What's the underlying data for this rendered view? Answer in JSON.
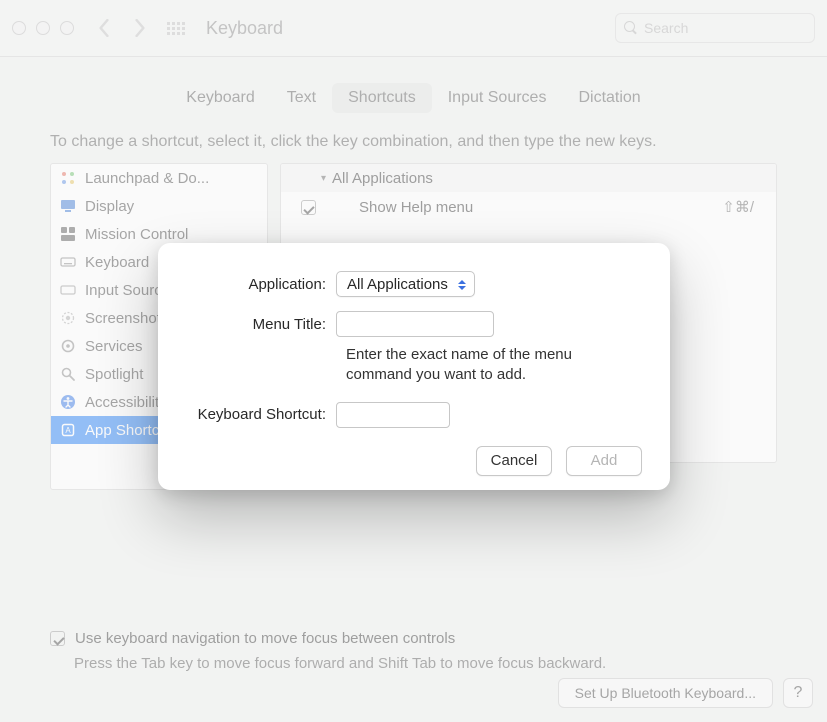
{
  "window": {
    "title": "Keyboard",
    "search_placeholder": "Search"
  },
  "tabs": {
    "items": [
      "Keyboard",
      "Text",
      "Shortcuts",
      "Input Sources",
      "Dictation"
    ],
    "active_index": 2
  },
  "instructions": "To change a shortcut, select it, click the key combination, and then type the new keys.",
  "sidebar": {
    "items": [
      {
        "label": "Launchpad & Do...",
        "icon": "launchpad"
      },
      {
        "label": "Display",
        "icon": "display"
      },
      {
        "label": "Mission Control",
        "icon": "mission"
      },
      {
        "label": "Keyboard",
        "icon": "keyboard"
      },
      {
        "label": "Input Sources",
        "icon": "input"
      },
      {
        "label": "Screenshots",
        "icon": "screenshot"
      },
      {
        "label": "Services",
        "icon": "services"
      },
      {
        "label": "Spotlight",
        "icon": "spotlight"
      },
      {
        "label": "Accessibility",
        "icon": "accessibility"
      },
      {
        "label": "App Shortcuts",
        "icon": "apps"
      }
    ],
    "selected_index": 9
  },
  "shortcuts": {
    "group_label": "All Applications",
    "rows": [
      {
        "checked": true,
        "label": "Show Help menu",
        "keys": "⇧⌘/"
      }
    ]
  },
  "buttons": {
    "add": "+",
    "remove": "–"
  },
  "footer": {
    "checkbox_label": "Use keyboard navigation to move focus between controls",
    "note": "Press the Tab key to move focus forward and Shift Tab to move focus backward.",
    "bluetooth": "Set Up Bluetooth Keyboard...",
    "help": "?"
  },
  "sheet": {
    "application_label": "Application:",
    "application_value": "All Applications",
    "menu_title_label": "Menu Title:",
    "menu_title_value": "",
    "help_text": "Enter the exact name of the menu command you want to add.",
    "shortcut_label": "Keyboard Shortcut:",
    "shortcut_value": "",
    "cancel": "Cancel",
    "add": "Add"
  }
}
